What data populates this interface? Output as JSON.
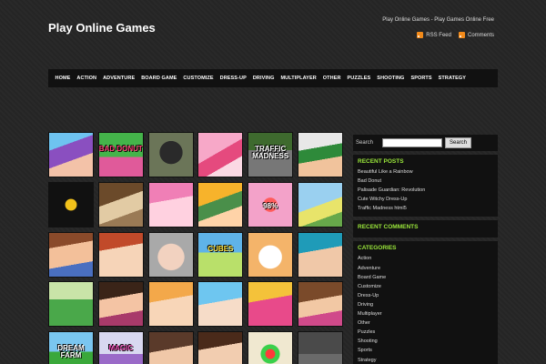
{
  "header": {
    "title": "Play Online Games",
    "tagline": "Play Online Games - Play Games Online Free",
    "rss_feed": "RSS Feed",
    "comments": "Comments"
  },
  "nav": {
    "items": [
      "HOME",
      "ACTION",
      "ADVENTURE",
      "BOARD GAME",
      "CUSTOMIZE",
      "DRESS-UP",
      "DRIVING",
      "MULTIPLAYER",
      "OTHER",
      "PUZZLES",
      "SHOOTING",
      "SPORTS",
      "STRATEGY"
    ]
  },
  "games": {
    "labels": [
      "BAD DONUT",
      "TRAFFIC MADNESS",
      "98%",
      "CUBES",
      "DREAM FARM",
      "MAGIC"
    ]
  },
  "sidebar": {
    "search": {
      "label": "Search",
      "button": "Search"
    },
    "recent_posts": {
      "title": "RECENT POSTS",
      "items": [
        "Beautiful Like a Rainbow",
        "Bad Donut",
        "Palisade Guardian: Revolution",
        "Cute Witchy Dress-Up",
        "Traffic Madness html5"
      ]
    },
    "recent_comments": {
      "title": "RECENT COMMENTS"
    },
    "categories": {
      "title": "CATEGORIES",
      "items": [
        "Action",
        "Adventure",
        "Board Game",
        "Customize",
        "Dress-Up",
        "Driving",
        "Multiplayer",
        "Other",
        "Puzzles",
        "Shooting",
        "Sports",
        "Strategy"
      ]
    }
  },
  "colors": {
    "background": "#262626",
    "accent": "#9be83b",
    "nav_bg": "#111111",
    "rss": "#f28a1a"
  }
}
